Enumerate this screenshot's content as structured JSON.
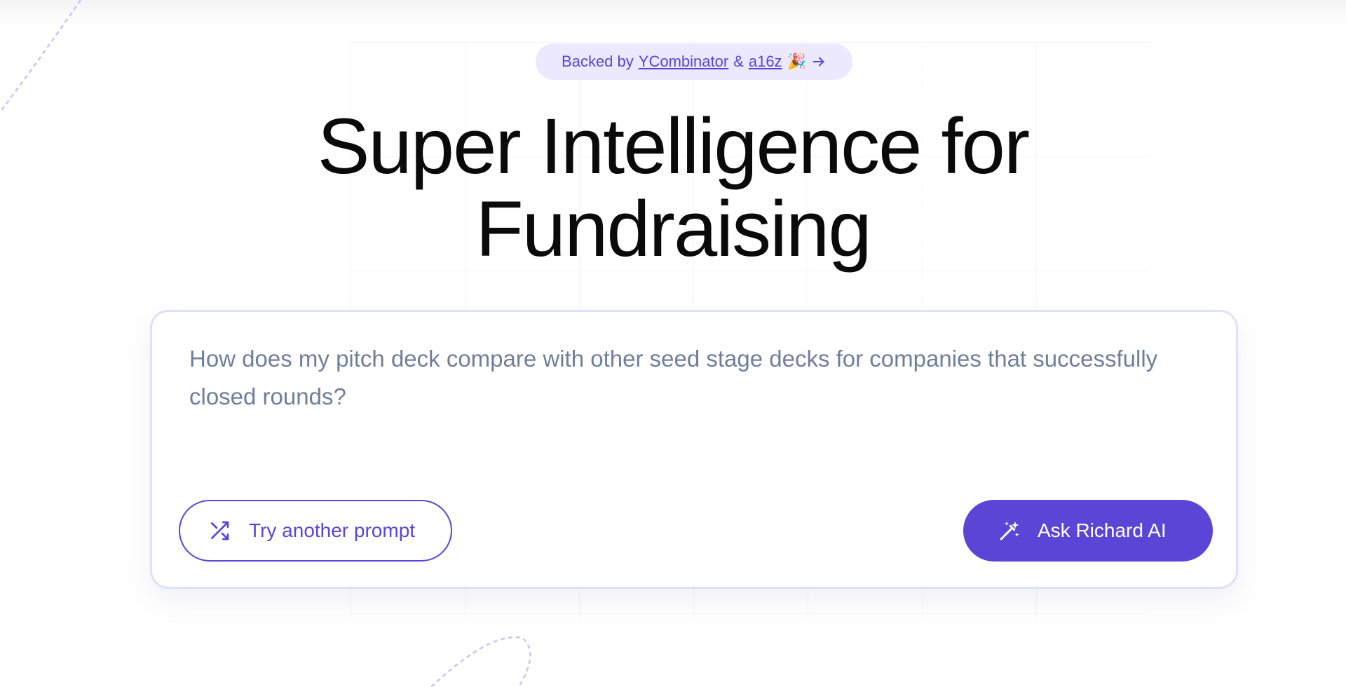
{
  "badge": {
    "prefix": "Backed by",
    "link1": "YCombinator",
    "connector": "&",
    "link2": "a16z",
    "emoji": "🎉",
    "arrow_icon": "arrow-right-icon"
  },
  "hero": {
    "line1": "Super Intelligence for",
    "line2": "Fundraising"
  },
  "prompt": {
    "text": "How does my pitch deck compare with other seed stage decks for companies that successfully closed rounds?"
  },
  "buttons": {
    "try_label": "Try another prompt",
    "try_icon": "shuffle-icon",
    "ask_label": "Ask Richard AI",
    "ask_icon": "magic-wand-icon"
  },
  "colors": {
    "accent": "#5b45d6",
    "badge_bg": "#ece8fd",
    "prompt_text": "#6e7f9c",
    "card_border": "#dde1fb"
  }
}
